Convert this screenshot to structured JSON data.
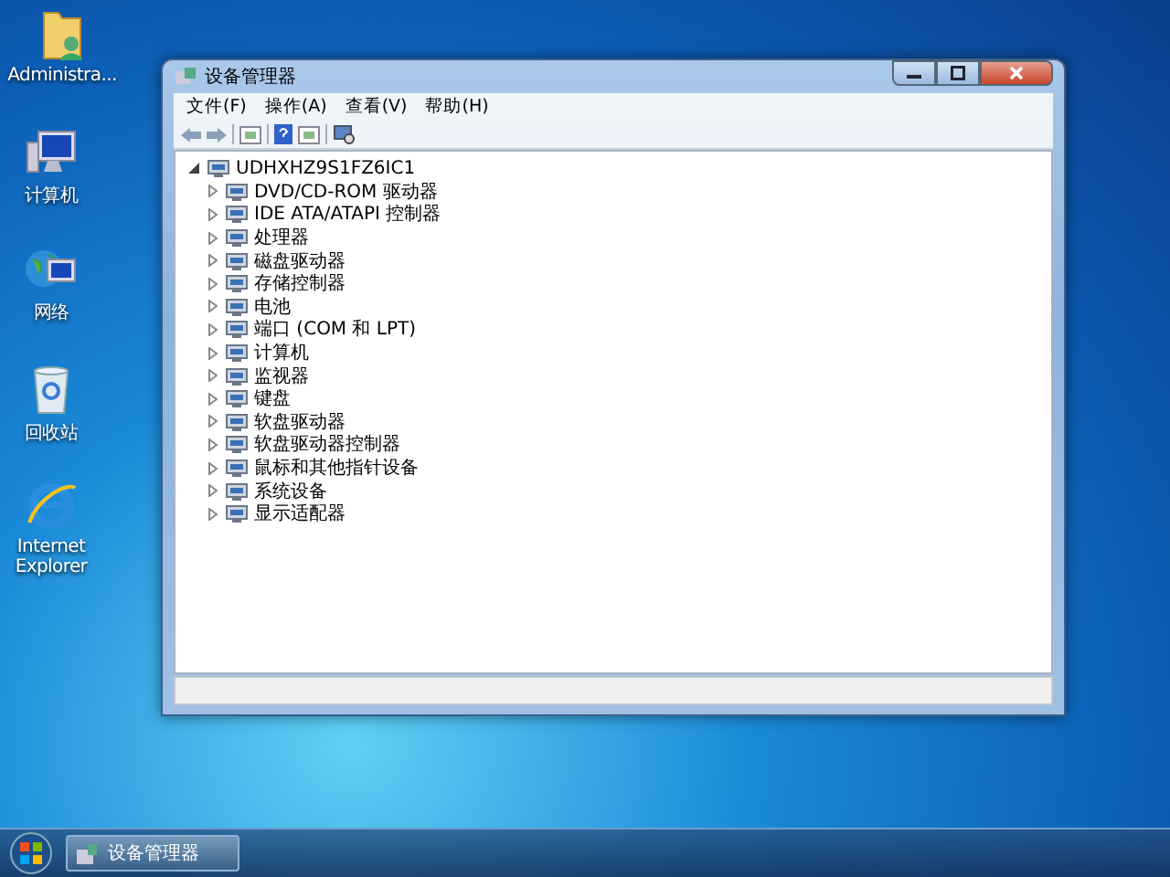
{
  "desktop_icons": [
    {
      "label": "Administra...",
      "kind": "folder"
    },
    {
      "label": "计算机",
      "kind": "computer"
    },
    {
      "label": "网络",
      "kind": "network"
    },
    {
      "label": "回收站",
      "kind": "recycle"
    },
    {
      "label": "Internet Explorer",
      "kind": "browser"
    }
  ],
  "window": {
    "title": "设备管理器",
    "menu": [
      "文件(F)",
      "操作(A)",
      "查看(V)",
      "帮助(H)"
    ],
    "tree": {
      "label": "UDHXHZ9S1FZ6IC1",
      "expanded": true,
      "children": [
        {
          "label": "DVD/CD-ROM 驱动器",
          "expanded": false
        },
        {
          "label": "IDE ATA/ATAPI 控制器",
          "expanded": false
        },
        {
          "label": "处理器",
          "expanded": false
        },
        {
          "label": "磁盘驱动器",
          "expanded": false
        },
        {
          "label": "存储控制器",
          "expanded": false
        },
        {
          "label": "电池",
          "expanded": false
        },
        {
          "label": "端口 (COM 和 LPT)",
          "expanded": false
        },
        {
          "label": "计算机",
          "expanded": false
        },
        {
          "label": "监视器",
          "expanded": false
        },
        {
          "label": "键盘",
          "expanded": false
        },
        {
          "label": "软盘驱动器",
          "expanded": false
        },
        {
          "label": "软盘驱动器控制器",
          "expanded": false
        },
        {
          "label": "鼠标和其他指针设备",
          "expanded": false
        },
        {
          "label": "系统设备",
          "expanded": false
        },
        {
          "label": "显示适配器",
          "expanded": false
        }
      ]
    }
  },
  "taskbar": {
    "tasks": [
      {
        "label": "设备管理器",
        "selected": true
      }
    ]
  }
}
